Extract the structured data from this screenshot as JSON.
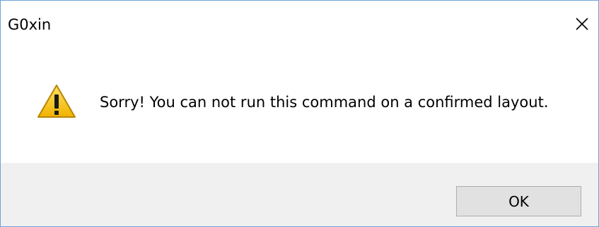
{
  "window": {
    "title": "G0xin",
    "close_icon": "close-icon"
  },
  "message": {
    "icon": "warning-icon",
    "text": "Sorry! You can not run this command on a confirmed layout."
  },
  "buttons": {
    "ok_label": "OK"
  },
  "colors": {
    "border": "#6fa3d8",
    "footer_background": "#f0f0f0",
    "button_background": "#e1e1e1",
    "button_border": "#adadad",
    "warning_yellow": "#f7c600"
  }
}
